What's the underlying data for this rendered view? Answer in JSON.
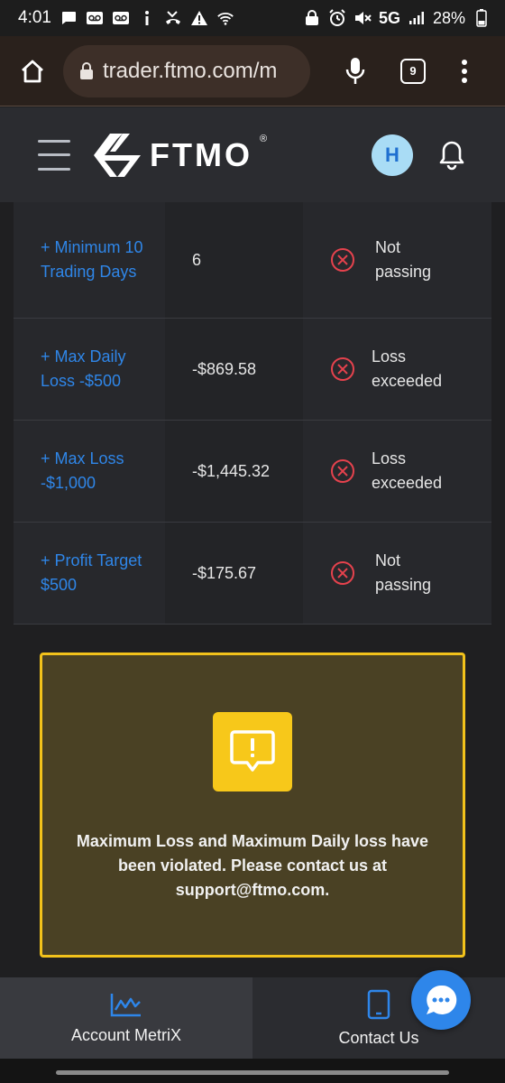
{
  "status_bar": {
    "time": "4:01",
    "network": "5G",
    "battery": "28%"
  },
  "browser": {
    "url": "trader.ftmo.com/m",
    "tab_count": "9"
  },
  "header": {
    "logo_text": "FTMO",
    "logo_mark": "®",
    "avatar_initial": "H"
  },
  "objectives": [
    {
      "name": "+ Minimum 10 Trading Days",
      "value": "6",
      "status": "Not passing"
    },
    {
      "name": "+ Max Daily Loss -$500",
      "value": "-$869.58",
      "status": "Loss exceeded"
    },
    {
      "name": "+ Max Loss -$1,000",
      "value": "-$1,445.32",
      "status": "Loss exceeded"
    },
    {
      "name": "+ Profit Target $500",
      "value": "-$175.67",
      "status": "Not passing"
    }
  ],
  "warning": {
    "message": "Maximum Loss and Maximum Daily loss have been violated. Please contact us at support@ftmo.com."
  },
  "bottom_nav": {
    "metrix_label": "Account MetriX",
    "contact_label": "Contact Us"
  },
  "colors": {
    "accent_blue": "#2f86e8",
    "error_red": "#e5424d",
    "warning_yellow": "#f7c81a"
  }
}
